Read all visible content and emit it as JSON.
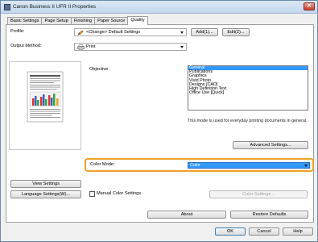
{
  "window": {
    "title": "Canon Business II UFR II Properties",
    "close_label": "✕"
  },
  "tabs": [
    {
      "label": "Basic Settings"
    },
    {
      "label": "Page Setup"
    },
    {
      "label": "Finishing"
    },
    {
      "label": "Paper Source"
    },
    {
      "label": "Quality"
    }
  ],
  "profile": {
    "label": "Profile:",
    "value": "<Change> Default Settings",
    "add_label": "Add(1)...",
    "edit_label": "Edit(2)..."
  },
  "output_method": {
    "label": "Output Method:",
    "value": "Print"
  },
  "objective": {
    "label": "Objective:",
    "items": [
      "General",
      "Publications",
      "Graphics",
      "Vivid Photo",
      "Designs [CAD]",
      "High Definition Text",
      "Office Use [Quick]"
    ],
    "selected_index": 0,
    "description": "This mode is used for everyday printing documents in general."
  },
  "advanced_settings_label": "Advanced Settings...",
  "color_mode": {
    "label": "Color Mode:",
    "value": "Color"
  },
  "view_settings_label": "View Settings",
  "language_settings_label": "Language Settings(W)...",
  "manual_color_label": "Manual Color Settings",
  "color_settings_label": "Color Settings...",
  "about_label": "About",
  "restore_label": "Restore Defaults",
  "footer": {
    "ok": "OK",
    "cancel": "Cancel",
    "help": "Help"
  }
}
